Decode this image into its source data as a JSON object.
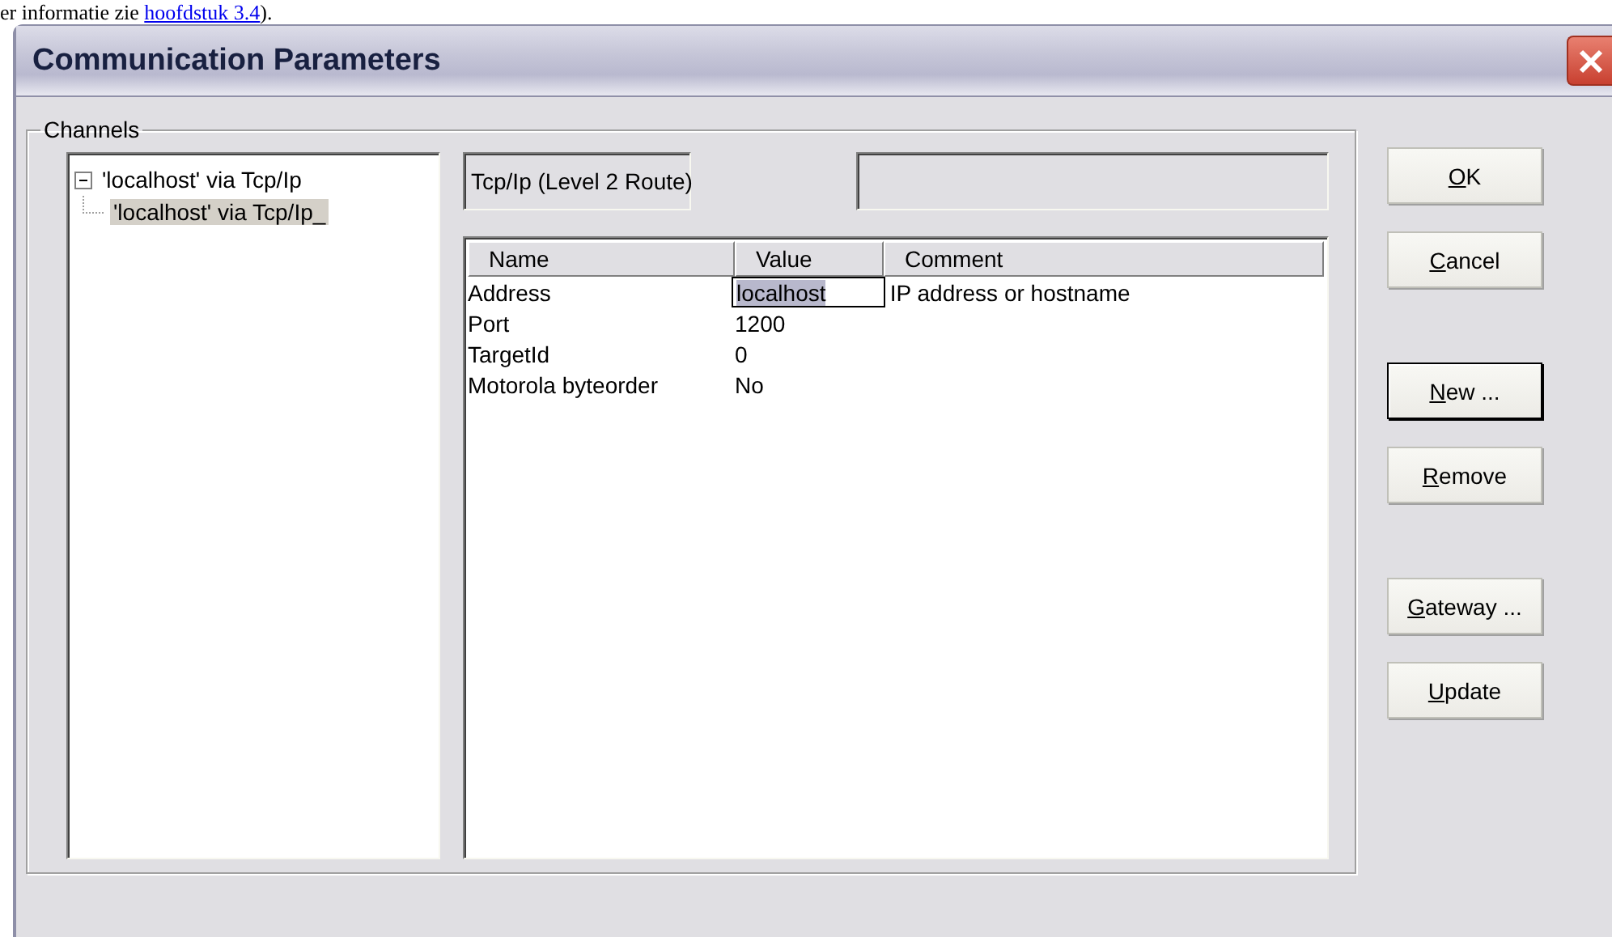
{
  "background_text": {
    "before": "er informatie zie ",
    "link": "hoofdstuk 3.4",
    "after": ")."
  },
  "window": {
    "title": "Communication Parameters"
  },
  "channels": {
    "label": "Channels",
    "tree": [
      {
        "label": "'localhost' via Tcp/Ip",
        "expanded": true,
        "selected": false,
        "children": [
          {
            "label": "'localhost' via Tcp/Ip_",
            "selected": true
          }
        ]
      }
    ],
    "driver_field": "Tcp/Ip (Level 2 Route)",
    "table": {
      "columns": [
        "Name",
        "Value",
        "Comment"
      ],
      "rows": [
        {
          "name": "Address",
          "value": "localhost",
          "comment": "IP address or hostname",
          "editing": true
        },
        {
          "name": "Port",
          "value": "1200",
          "editing": false
        },
        {
          "name": "TargetId",
          "value": "0",
          "editing": false
        },
        {
          "name": "Motorola byteorder",
          "value": "No",
          "editing": false
        }
      ]
    }
  },
  "button_groups": [
    [
      {
        "label": "OK",
        "default": false
      },
      {
        "label": "Cancel",
        "default": false
      }
    ],
    [
      {
        "label": "New ...",
        "default": true
      },
      {
        "label": "Remove",
        "default": false
      }
    ],
    [
      {
        "label": "Gateway ...",
        "default": false
      },
      {
        "label": "Update",
        "default": false
      }
    ]
  ]
}
